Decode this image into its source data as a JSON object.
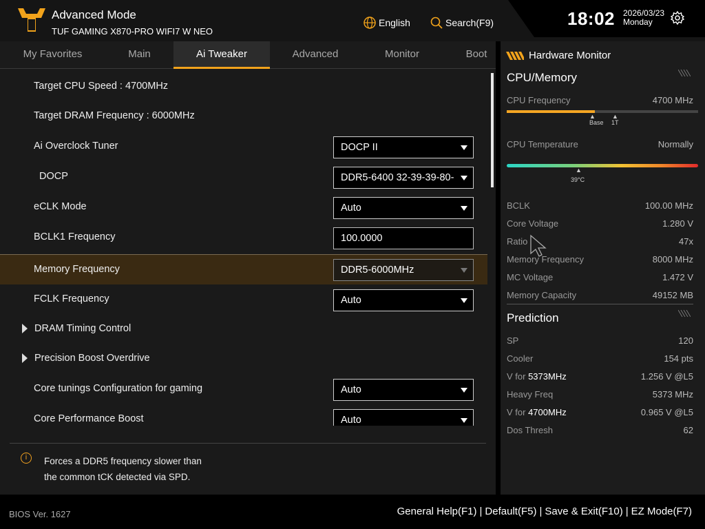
{
  "header": {
    "title": "Advanced Mode",
    "model": "TUF GAMING X870-PRO WIFI7 W NEO",
    "language_label": "English",
    "search_label": "Search(F9)",
    "time": "18:02",
    "date": "2026/03/23",
    "weekday": "Monday",
    "icons": [
      "tuf-logo-icon",
      "globe-icon",
      "search-icon",
      "gear-icon"
    ]
  },
  "tabs": [
    "My Favorites",
    "Main",
    "Ai Tweaker",
    "Advanced",
    "Monitor",
    "Boot"
  ],
  "active_tab": "Ai Tweaker",
  "settings": {
    "target_cpu": "Target CPU Speed : 4700MHz",
    "target_dram": "Target DRAM Frequency : 6000MHz",
    "ai_oc_label": "Ai Overclock Tuner",
    "ai_oc_value": "DOCP II",
    "docp_label": "DOCP",
    "docp_value": "DDR5-6400 32-39-39-80-",
    "eclk_label": "eCLK Mode",
    "eclk_value": "Auto",
    "bclk_label": "BCLK1 Frequency",
    "bclk_value": "100.0000",
    "memfreq_label": "Memory Frequency",
    "memfreq_value": "DDR5-6000MHz",
    "fclk_label": "FCLK Frequency",
    "fclk_value": "Auto",
    "dram_timing_label": "DRAM Timing Control",
    "pbo_label": "Precision Boost Overdrive",
    "core_tuning_label": "Core tunings Configuration for gaming",
    "core_tuning_value": "Auto",
    "cpb_label": "Core Performance Boost",
    "cpb_value": "Auto"
  },
  "help_text": {
    "line1": "Forces a DDR5 frequency slower than",
    "line2": "the common tCK detected via SPD."
  },
  "hw_monitor": {
    "title": "Hardware Monitor",
    "cpu_section": "CPU/Memory",
    "cpu_freq_label": "CPU Frequency",
    "cpu_freq_value": "4700 MHz",
    "cpu_freq_level": 0.46,
    "marker_base": "Base",
    "marker_1t": "1T",
    "cpu_temp_label": "CPU Temperature",
    "cpu_temp_value": "Normally",
    "temp_marker": "39°C",
    "bclk_label": "BCLK",
    "bclk_value": "100.00 MHz",
    "core_voltage_label": "Core Voltage",
    "core_voltage_value": "1.280 V",
    "ratio_label": "Ratio",
    "ratio_value": "47x",
    "mem_freq_label": "Memory Frequency",
    "mem_freq_value": "8000 MHz",
    "mc_voltage_label": "MC Voltage",
    "mc_voltage_value": "1.472 V",
    "mem_cap_label": "Memory Capacity",
    "mem_cap_value": "49152 MB",
    "prediction_section": "Prediction",
    "sp_label": "SP",
    "sp_value": "120",
    "cooler_label": "Cooler",
    "cooler_value": "154 pts",
    "vfor1_prefix": "V for ",
    "vfor1_freq": "5373MHz",
    "vfor1_value": "1.256 V @L5",
    "heavy_label": "Heavy Freq",
    "heavy_value": "5373 MHz",
    "vfor2_prefix": "V for ",
    "vfor2_freq": "4700MHz",
    "vfor2_value": "0.965 V @L5",
    "dos_label": "Dos Thresh",
    "dos_value": "62"
  },
  "footer": {
    "bios_version": "BIOS Ver. 1627",
    "general_help": "General Help(F1)",
    "default": "Default(F5)",
    "save_exit": "Save & Exit(F10)",
    "ez_mode": "EZ Mode(F7)",
    "separator": "|"
  },
  "colors": {
    "accent": "#f2a31b",
    "highlight_row": "#3a2a12",
    "panel_bg": "#1a1a1a"
  }
}
